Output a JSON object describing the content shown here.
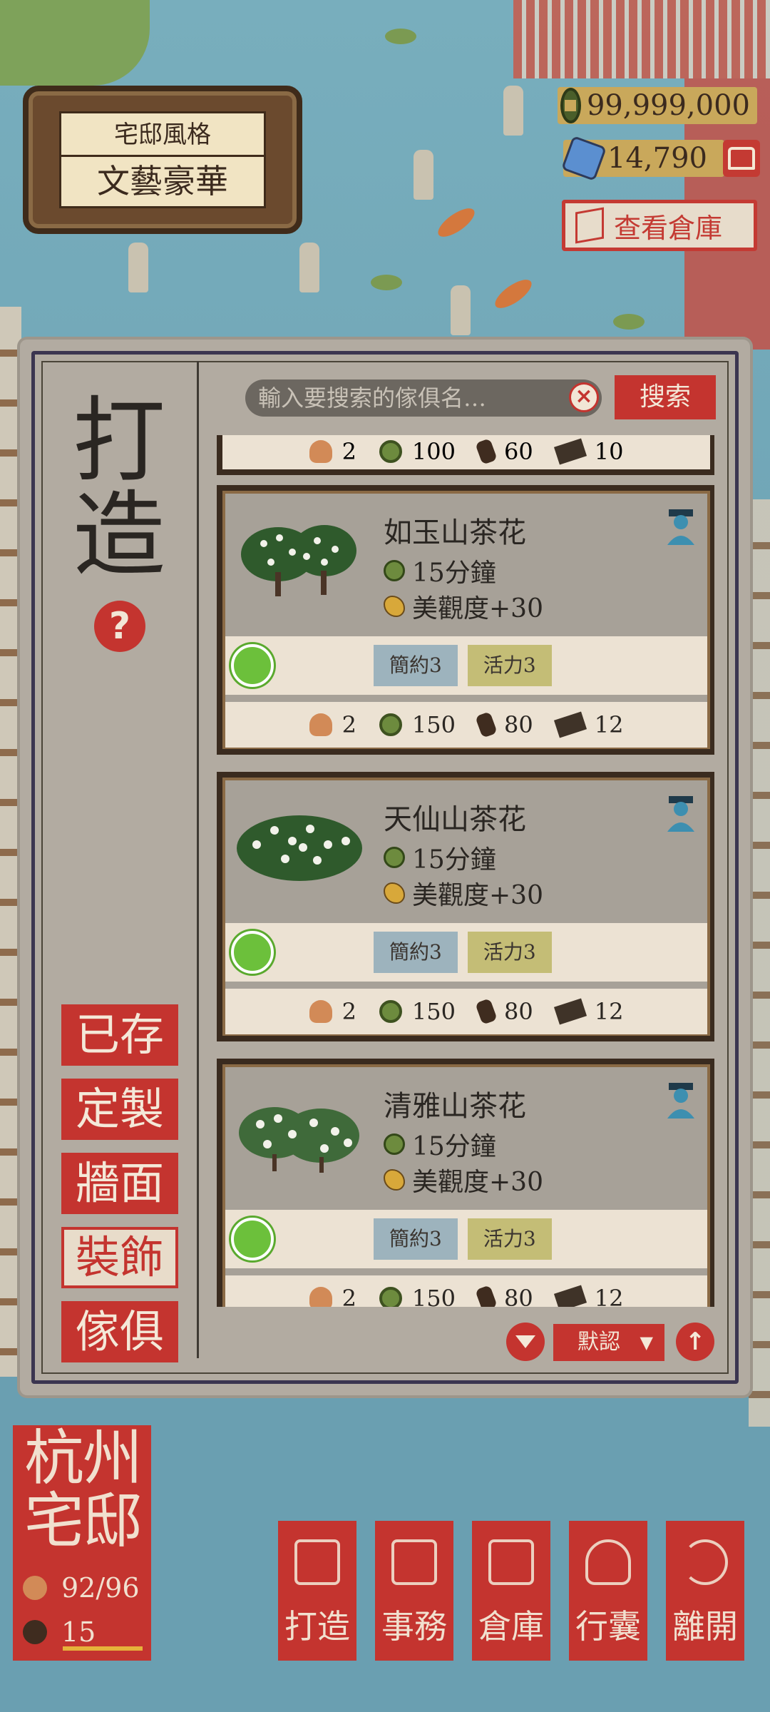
{
  "style_sign": {
    "label": "宅邸風格",
    "value": "文藝豪華"
  },
  "currency": {
    "coins": "99,999,000",
    "gems": "14,790",
    "coin_icon": "copper-coin-icon",
    "gem_icon": "jade-gem-icon"
  },
  "warehouse_button": "查看倉庫",
  "panel": {
    "title": "打造",
    "help": "?",
    "search": {
      "placeholder": "輸入要搜索的傢俱名…",
      "button": "搜索"
    },
    "categories": [
      {
        "label": "已存",
        "active": false
      },
      {
        "label": "定製",
        "active": false
      },
      {
        "label": "牆面",
        "active": false
      },
      {
        "label": "裝飾",
        "active": true
      },
      {
        "label": "傢俱",
        "active": false
      }
    ],
    "partial_cost": {
      "workers": "2",
      "coins": "100",
      "wood": "60",
      "planks": "10"
    },
    "items": [
      {
        "name": "如玉山茶花",
        "time": "15分鐘",
        "beauty": "美觀度+30",
        "tags": [
          "簡約3",
          "活力3"
        ],
        "cost": {
          "workers": "2",
          "coins": "150",
          "wood": "80",
          "planks": "12"
        }
      },
      {
        "name": "天仙山茶花",
        "time": "15分鐘",
        "beauty": "美觀度+30",
        "tags": [
          "簡約3",
          "活力3"
        ],
        "cost": {
          "workers": "2",
          "coins": "150",
          "wood": "80",
          "planks": "12"
        }
      },
      {
        "name": "清雅山茶花",
        "time": "15分鐘",
        "beauty": "美觀度+30",
        "tags": [
          "簡約3",
          "活力3"
        ],
        "cost": {
          "workers": "2",
          "coins": "150",
          "wood": "80",
          "planks": "12"
        }
      }
    ],
    "sort": {
      "selected": "默認",
      "chevron": "▼"
    },
    "top_arrow": "↑"
  },
  "location": {
    "name_line1": "杭州",
    "name_line2": "宅邸",
    "population": "92/96",
    "level": "15"
  },
  "nav": [
    {
      "label": "打造",
      "icon": "hammer-icon"
    },
    {
      "label": "事務",
      "icon": "abacus-icon"
    },
    {
      "label": "倉庫",
      "icon": "storehouse-icon"
    },
    {
      "label": "行囊",
      "icon": "bundle-icon"
    },
    {
      "label": "離開",
      "icon": "return-icon"
    }
  ],
  "colors": {
    "accent_red": "#c4342f",
    "paper": "#ece2d3",
    "water": "#6fa4b5",
    "tag_blue": "#9db3bd",
    "tag_olive": "#c4bd76"
  }
}
